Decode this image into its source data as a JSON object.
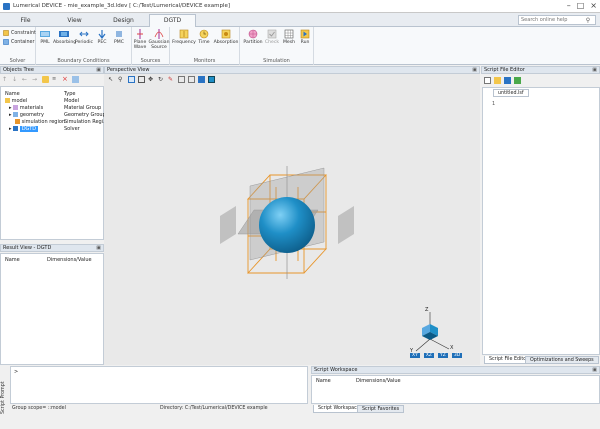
{
  "window": {
    "title": "Lumerical DEVICE - mie_example_3d.ldev [ C:/Test/Lumerical/DEVICE example]",
    "minimize": "–",
    "maximize": "□",
    "close": "×"
  },
  "tabs": [
    {
      "label": "File"
    },
    {
      "label": "View"
    },
    {
      "label": "Design"
    },
    {
      "label": "DGTD"
    }
  ],
  "search": {
    "placeholder": "Search online help",
    "icon": "search-icon"
  },
  "ribbon": {
    "solver": {
      "label": "Solver",
      "constraint": "Constraint",
      "container": "Container"
    },
    "boundary": {
      "label": "Boundary Conditions",
      "pml": "PML",
      "absorbing": "Absorbing",
      "periodic": "Periodic",
      "pec": "PEC",
      "pmc": "PMC"
    },
    "sources": {
      "label": "Sources",
      "plane_wave": "Plane Wave",
      "gaussian": "Gaussian Source"
    },
    "monitors": {
      "label": "Monitors",
      "frequency": "Frequency",
      "time": "Time",
      "absorption": "Absorption"
    },
    "simulation": {
      "label": "Simulation",
      "partition": "Partition",
      "check": "Check",
      "mesh": "Mesh",
      "run": "Run"
    }
  },
  "objects_tree": {
    "title": "Objects Tree",
    "columns": {
      "name": "Name",
      "type": "Type"
    },
    "rows": [
      {
        "name": "model",
        "type": "Model"
      },
      {
        "name": "materials",
        "type": "Material Group"
      },
      {
        "name": "geometry",
        "type": "Geometry Group"
      },
      {
        "name": "simulation region",
        "type": "Simulation Regi..."
      },
      {
        "name": "DGTD",
        "type": "Solver"
      }
    ]
  },
  "result_view": {
    "title": "Result View - DGTD",
    "columns": {
      "name": "Name",
      "dims": "Dimensions/Value"
    }
  },
  "perspective": {
    "title": "Perspective View",
    "axes": {
      "x": "X",
      "y": "Y",
      "z": "Z"
    },
    "view_buttons": [
      "XY",
      "XZ",
      "YZ",
      "3D"
    ]
  },
  "script_editor": {
    "title": "Script File Editor",
    "file_tab": "untitled.lsf",
    "line1": "1",
    "tabs": [
      "Script File Editor",
      "Optimizations and Sweeps"
    ]
  },
  "script_prompt": {
    "side_label": "Script Prompt",
    "prompt": ">"
  },
  "script_workspace": {
    "title": "Script Workspace",
    "columns": {
      "name": "Name",
      "dims": "Dimensions/Value"
    },
    "tabs": [
      "Script Workspace",
      "Script Favorites"
    ]
  },
  "status": {
    "group_scope": "Group scope= ::model",
    "directory": "Directory: C:/Test/Lumerical/DEVICE example"
  },
  "colors": {
    "accent": "#2a73c4",
    "sphere": "#1f8fc7",
    "frame": "#e8952a",
    "selection": "#3399ff"
  }
}
